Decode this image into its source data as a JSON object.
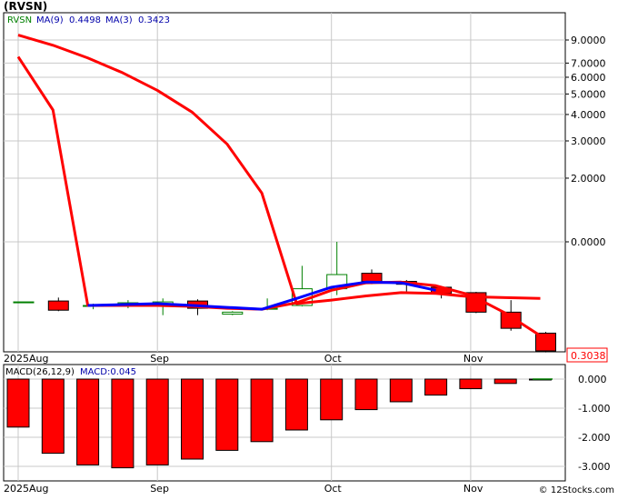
{
  "title": "(RVSN)",
  "watermark": "© 12Stocks.com",
  "colors": {
    "background": "#ffffff",
    "grid": "#c8c8c8",
    "frame": "#000000",
    "up_candle": "#008000",
    "down_candle": "#ff0000",
    "ma_fast": "#ff0000",
    "ma_slow": "#0000ff",
    "macd_bar": "#ff0000",
    "macd_signal": "#008000",
    "label_green": "#008000",
    "label_blue": "#0000aa",
    "price_tag": "#ff0000"
  },
  "chart_data": [
    {
      "type": "candlestick",
      "legend": {
        "symbol": "RVSN",
        "ma9": "MA(9)",
        "ma9_value": "0.4498",
        "ma3": "MA(3)",
        "ma3_value": "0.3423"
      },
      "y_scale": "log",
      "last_price": "0.3038",
      "y_ticks": [
        {
          "value": 9.0,
          "label": "9.0000"
        },
        {
          "value": 7.0,
          "label": "7.0000"
        },
        {
          "value": 6.0,
          "label": "6.0000"
        },
        {
          "value": 5.0,
          "label": "5.0000"
        },
        {
          "value": 4.0,
          "label": "4.0000"
        },
        {
          "value": 3.0,
          "label": "3.0000"
        },
        {
          "value": 2.0,
          "label": "2.0000"
        },
        {
          "value": 1.0,
          "label": "0.0000"
        }
      ],
      "x_labels": [
        {
          "index": 0,
          "label": "2025Aug"
        },
        {
          "index": 4,
          "label": "Sep"
        },
        {
          "index": 9,
          "label": "Oct"
        },
        {
          "index": 13,
          "label": "Nov"
        }
      ],
      "candles": [
        {
          "date": "2025-07-25",
          "open": 0.52,
          "high": 0.52,
          "low": 0.52,
          "close": 0.52
        },
        {
          "date": "2025-08-01",
          "open": 0.525,
          "high": 0.545,
          "low": 0.47,
          "close": 0.475
        },
        {
          "date": "2025-08-08",
          "open": 0.5,
          "high": 0.51,
          "low": 0.48,
          "close": 0.5
        },
        {
          "date": "2025-08-15",
          "open": 0.5,
          "high": 0.53,
          "low": 0.485,
          "close": 0.515
        },
        {
          "date": "2025-08-22",
          "open": 0.51,
          "high": 0.54,
          "low": 0.45,
          "close": 0.52
        },
        {
          "date": "2025-08-29",
          "open": 0.525,
          "high": 0.535,
          "low": 0.45,
          "close": 0.485
        },
        {
          "date": "2025-09-05",
          "open": 0.455,
          "high": 0.47,
          "low": 0.45,
          "close": 0.465
        },
        {
          "date": "2025-09-12",
          "open": 0.48,
          "high": 0.54,
          "low": 0.475,
          "close": 0.485
        },
        {
          "date": "2025-09-19",
          "open": 0.5,
          "high": 0.77,
          "low": 0.495,
          "close": 0.6
        },
        {
          "date": "2025-09-26",
          "open": 0.6,
          "high": 1.0,
          "low": 0.56,
          "close": 0.7
        },
        {
          "date": "2025-10-03",
          "open": 0.71,
          "high": 0.74,
          "low": 0.63,
          "close": 0.65
        },
        {
          "date": "2025-10-10",
          "open": 0.65,
          "high": 0.66,
          "low": 0.58,
          "close": 0.63
        },
        {
          "date": "2025-10-17",
          "open": 0.61,
          "high": 0.615,
          "low": 0.54,
          "close": 0.57
        },
        {
          "date": "2025-10-24",
          "open": 0.575,
          "high": 0.58,
          "low": 0.46,
          "close": 0.465
        },
        {
          "date": "2025-10-31",
          "open": 0.465,
          "high": 0.53,
          "low": 0.38,
          "close": 0.39
        },
        {
          "date": "2025-11-07",
          "open": 0.37,
          "high": 0.375,
          "low": 0.3,
          "close": 0.305
        }
      ],
      "series": [
        {
          "name": "MA(9)",
          "color": "#ff0000",
          "values": [
            9.5,
            8.5,
            7.4,
            6.3,
            5.2,
            4.1,
            2.9,
            1.7,
            0.51,
            0.53,
            0.555,
            0.575,
            0.57,
            0.55,
            0.545,
            0.54
          ]
        },
        {
          "name": "MA(3)",
          "color": "#ff0000",
          "values": [
            7.5,
            4.2,
            0.5,
            0.5,
            0.5,
            0.495,
            0.485,
            0.48,
            0.515,
            0.59,
            0.64,
            0.645,
            0.62,
            0.56,
            0.46,
            0.36
          ]
        },
        {
          "name": "MA(3)-blue",
          "color": "#0000ff",
          "values": [
            null,
            null,
            0.5,
            0.505,
            0.51,
            0.5,
            0.49,
            0.48,
            0.54,
            0.61,
            0.645,
            0.64,
            0.59,
            null,
            null,
            null
          ]
        }
      ]
    },
    {
      "type": "bar",
      "legend": {
        "label": "MACD(26,12,9)",
        "value_label": "MACD:0.045"
      },
      "ylim": [
        -3.0,
        0.0
      ],
      "y_ticks": [
        {
          "value": 0.0,
          "label": "0.000"
        },
        {
          "value": -1.0,
          "label": "-1.000"
        },
        {
          "value": -2.0,
          "label": "-2.000"
        },
        {
          "value": -3.0,
          "label": "-3.000"
        }
      ],
      "x_labels": [
        {
          "index": 0,
          "label": "2025Aug"
        },
        {
          "index": 4,
          "label": "Sep"
        },
        {
          "index": 9,
          "label": "Oct"
        },
        {
          "index": 13,
          "label": "Nov"
        }
      ],
      "values": [
        -1.65,
        -2.55,
        -2.95,
        -3.05,
        -2.95,
        -2.75,
        -2.45,
        -2.15,
        -1.75,
        -1.4,
        -1.05,
        -0.78,
        -0.55,
        -0.33,
        -0.15,
        -0.02
      ]
    }
  ]
}
